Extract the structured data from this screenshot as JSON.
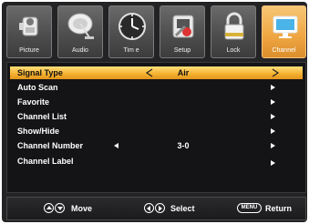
{
  "tabs": [
    {
      "label": "Picture",
      "icon": "camera-icon",
      "active": false
    },
    {
      "label": "Audio",
      "icon": "satellite-dish-icon",
      "active": false
    },
    {
      "label": "Tim e",
      "icon": "clock-icon",
      "active": false
    },
    {
      "label": "Setup",
      "icon": "wrench-icon",
      "active": false
    },
    {
      "label": "Lock",
      "icon": "padlock-icon",
      "active": false
    },
    {
      "label": "Channel",
      "icon": "tv-monitor-icon",
      "active": true
    }
  ],
  "menu": {
    "items": [
      {
        "label": "Signal Type",
        "value": "Air",
        "selected": true
      },
      {
        "label": "Auto Scan",
        "value": ""
      },
      {
        "label": "Favorite",
        "value": ""
      },
      {
        "label": "Channel List",
        "value": ""
      },
      {
        "label": "Show/Hide",
        "value": ""
      },
      {
        "label": "Channel Number",
        "value": "3-0"
      },
      {
        "label": "Channel Label",
        "value": ""
      }
    ]
  },
  "footer": {
    "move_label": "Move",
    "select_label": "Select",
    "menu_key": "MENU",
    "return_label": "Return"
  },
  "colors": {
    "accent": "#f0a845",
    "selected_row": "#f4b02f",
    "background": "#232325"
  }
}
